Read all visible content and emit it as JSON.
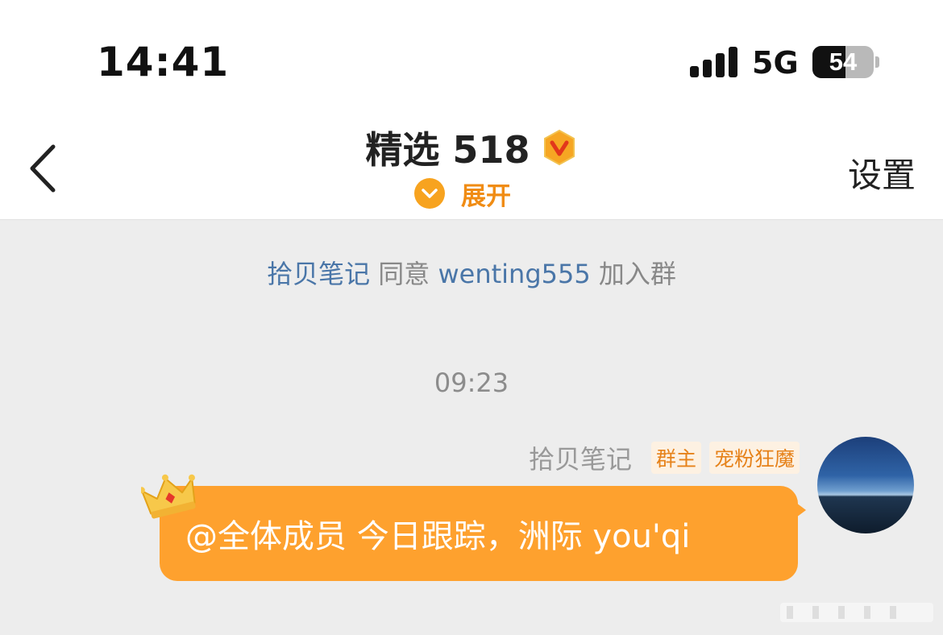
{
  "status_bar": {
    "time": "14:41",
    "network": "5G",
    "battery": "54",
    "battery_level": 0.54
  },
  "nav": {
    "title": "精选 518",
    "expand_label": "展开",
    "settings_label": "设置",
    "accent_color": "#f7a31f"
  },
  "system_message": {
    "actor": "拾贝笔记",
    "verb": "同意",
    "target": "wenting555",
    "suffix": "加入群"
  },
  "timestamp": "09:23",
  "message": {
    "sender": "拾贝笔记",
    "tags": [
      "群主",
      "宠粉狂魔"
    ],
    "text": "@全体成员 今日跟踪，洲际 you'qi",
    "bubble_color": "#fea12e"
  },
  "icons": {
    "back": "chevron-left-icon",
    "verified": "v-badge-icon",
    "expand": "chevron-down-icon",
    "crown": "crown-icon"
  }
}
